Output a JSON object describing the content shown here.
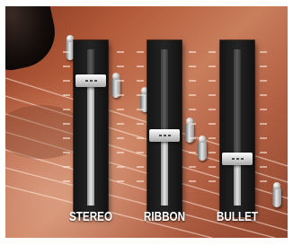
{
  "faders": [
    {
      "id": "stereo",
      "label": "STEREO",
      "level": 0.8
    },
    {
      "id": "ribbon",
      "label": "RIBBON",
      "level": 0.45
    },
    {
      "id": "bullet",
      "label": "BULLET",
      "level": 0.3
    }
  ],
  "colors": {
    "background": "#b35a3a",
    "fader_body": "#1c1c1c",
    "label": "#ffffff"
  }
}
